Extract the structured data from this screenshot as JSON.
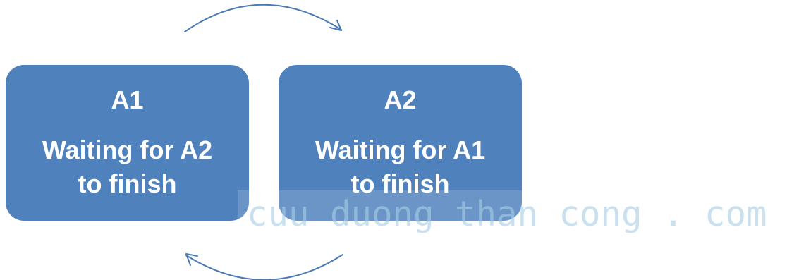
{
  "nodes": [
    {
      "id": "A1",
      "label": "A1",
      "lines": [
        "Waiting for A2",
        "to finish"
      ]
    },
    {
      "id": "A2",
      "label": "A2",
      "lines": [
        "Waiting for A1",
        "to finish"
      ]
    }
  ],
  "edges": [
    {
      "from": "A1",
      "to": "A2",
      "style": "curved-arrow-top"
    },
    {
      "from": "A2",
      "to": "A1",
      "style": "curved-arrow-bottom"
    }
  ],
  "colors": {
    "box_fill": "#4f81bd",
    "box_text": "#ffffff",
    "arrow": "#4a7ab5"
  },
  "watermark": "cuu duong than cong . com"
}
